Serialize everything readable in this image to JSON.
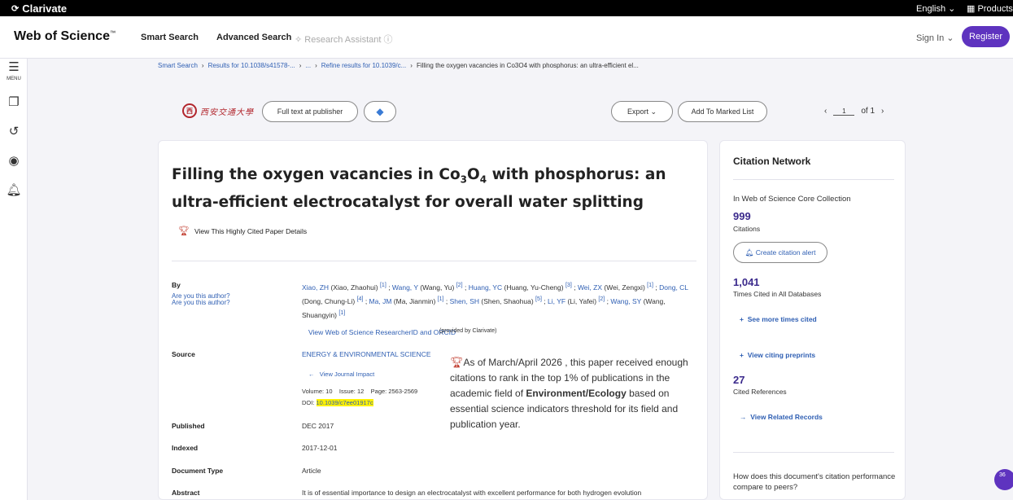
{
  "topbar": {
    "brand": "Clarivate",
    "language": "English ⌄",
    "products": "Products"
  },
  "header": {
    "logo": "Web of Science",
    "logo_tm": "™",
    "nav": {
      "smart_search": "Smart Search",
      "advanced_search": "Advanced Search",
      "research_assistant": "Research Assistant ⓘ"
    },
    "sign_in": "Sign In ⌄",
    "register": "Register"
  },
  "rail": {
    "menu_label": "MENU"
  },
  "breadcrumb": {
    "items": [
      "Smart Search",
      "Results for 10.1038/s41578-...",
      "...",
      "Refine results for 10.1039/c...",
      "Filling the oxygen vacancies in Co3O4 with phosphorus: an ultra-efficient el..."
    ],
    "separator": "›"
  },
  "actions": {
    "university_seal": "西",
    "university_name": "西安交通大學",
    "full_text": "Full text at publisher",
    "export": "Export ⌄",
    "add_to_marked": "Add To Marked List",
    "page_prev": "‹",
    "page_current": "1",
    "page_of": "of 1",
    "page_next": "›"
  },
  "record": {
    "title_part1": "Filling the oxygen vacancies in Co",
    "title_sub1": "3",
    "title_part2": "O",
    "title_sub2": "4",
    "title_part3": " with phosphorus: an ultra-efficient electrocatalyst for overall water splitting",
    "highly_cited_link": "View This Highly Cited Paper Details",
    "labels": {
      "by": "By",
      "are_you_author_1": "Are you this author?",
      "are_you_author_2": "Are you this author?",
      "source": "Source",
      "published": "Published",
      "indexed": "Indexed",
      "document_type": "Document Type",
      "abstract": "Abstract"
    },
    "authors": [
      {
        "short": "Xiao, ZH",
        "full": "(Xiao, Zhaohui)",
        "ref": "[1]"
      },
      {
        "short": "Wang, Y",
        "full": "(Wang, Yu)",
        "ref": "[2]"
      },
      {
        "short": "Huang, YC",
        "full": "(Huang, Yu-Cheng)",
        "ref": "[3]"
      },
      {
        "short": "Wei, ZX",
        "full": "(Wei, Zengxi)",
        "ref": "[1]"
      },
      {
        "short": "Dong, CL",
        "full": "(Dong, Chung-Li)",
        "ref": "[4]"
      },
      {
        "short": "Ma, JM",
        "full": "(Ma, Jianmin)",
        "ref": "[1]"
      },
      {
        "short": "Shen, SH",
        "full": "(Shen, Shaohua)",
        "ref": "[5]"
      },
      {
        "short": "Li, YF",
        "full": "(Li, Yafei)",
        "ref": "[2]"
      },
      {
        "short": "Wang, SY",
        "full": "(Wang, Shuangyin)",
        "ref": "[1]"
      }
    ],
    "researcher_id_link": "View Web of Science ResearcherID and ORCID",
    "researcher_id_note": "(provided by Clarivate)",
    "journal": "ENERGY & ENVIRONMENTAL SCIENCE",
    "journal_impact": "View Journal Impact",
    "volume_label": "Volume: 10",
    "issue_label": "Issue: 12",
    "page_label": "Page: 2563-2569",
    "doi_label": "DOI:",
    "doi": "10.1039/c7ee01917c",
    "published": "DEC 2017",
    "indexed": "2017-12-01",
    "document_type": "Article",
    "abstract": "It is of essential importance to design an electrocatalyst with excellent performance for both hydrogen evolution",
    "hc_text_1": "As of March/April 2026 , this paper received enough citations to rank in the top 1% of publications in the academic field of ",
    "hc_field": "Environment/Ecology",
    "hc_text_2": " based on essential science indicators threshold for its field and publication year."
  },
  "citation_network": {
    "title": "Citation Network",
    "collection": "In Web of Science Core Collection",
    "citations": "999",
    "citations_label": "Citations",
    "create_alert": "Create citation alert",
    "times_cited_all": "1,041",
    "times_cited_all_label": "Times Cited in All Databases",
    "see_more": "See more times cited",
    "citing_preprints": "View citing preprints",
    "cited_refs": "27",
    "cited_refs_label": "Cited References",
    "related_records": "View Related Records",
    "peer_question": "How does this document's citation performance compare to peers?"
  },
  "badge": {
    "count": "36"
  },
  "colors": {
    "accent": "#5e33bf",
    "link": "#2f5fb3",
    "number": "#3b2a8c",
    "doi_highlight": "#fff200",
    "trophy": "#c0392b"
  }
}
